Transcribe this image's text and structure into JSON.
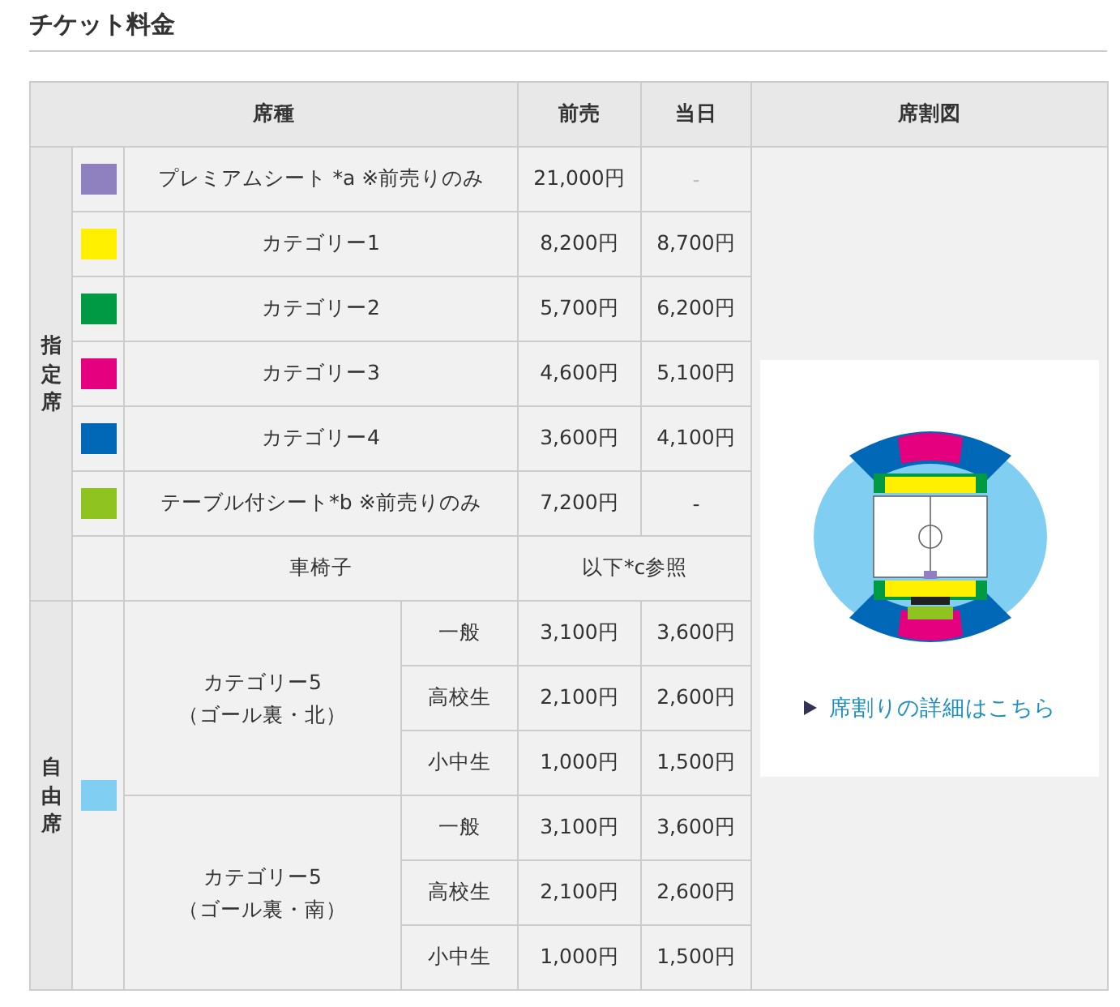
{
  "title": "チケット料金",
  "table": {
    "columns": [
      "席種",
      "前売",
      "当日",
      "席割図"
    ],
    "reserved": {
      "label": "指定席",
      "rows": [
        {
          "color": "#8f80bf",
          "name": "プレミアムシート *a ※前売りのみ",
          "advance": "21,000円",
          "same_day": "-",
          "same_day_muted": true
        },
        {
          "color": "#fff000",
          "name": "カテゴリー1",
          "advance": "8,200円",
          "same_day": "8,700円",
          "same_day_muted": false
        },
        {
          "color": "#009a44",
          "name": "カテゴリー2",
          "advance": "5,700円",
          "same_day": "6,200円",
          "same_day_muted": false
        },
        {
          "color": "#e4007f",
          "name": "カテゴリー3",
          "advance": "4,600円",
          "same_day": "5,100円",
          "same_day_muted": false
        },
        {
          "color": "#0068b7",
          "name": "カテゴリー4",
          "advance": "3,600円",
          "same_day": "4,100円",
          "same_day_muted": false
        },
        {
          "color": "#8fc31f",
          "name": "テーブル付シート*b ※前売りのみ",
          "advance": "7,200円",
          "same_day": "-",
          "same_day_muted": false
        }
      ],
      "wheelchair": {
        "name": "車椅子",
        "note": "以下*c参照"
      }
    },
    "free": {
      "label": "自由席",
      "color": "#80cff3",
      "areas": [
        {
          "name": "カテゴリー5",
          "sub": "（ゴール裏・北）",
          "tiers": [
            {
              "name": "一般",
              "advance": "3,100円",
              "same_day": "3,600円"
            },
            {
              "name": "高校生",
              "advance": "2,100円",
              "same_day": "2,600円"
            },
            {
              "name": "小中生",
              "advance": "1,000円",
              "same_day": "1,500円"
            }
          ]
        },
        {
          "name": "カテゴリー5",
          "sub": "（ゴール裏・南）",
          "tiers": [
            {
              "name": "一般",
              "advance": "3,100円",
              "same_day": "3,600円"
            },
            {
              "name": "高校生",
              "advance": "2,100円",
              "same_day": "2,600円"
            },
            {
              "name": "小中生",
              "advance": "1,000円",
              "same_day": "1,500円"
            }
          ]
        }
      ]
    },
    "map_link": "席割りの詳細はこちら"
  }
}
